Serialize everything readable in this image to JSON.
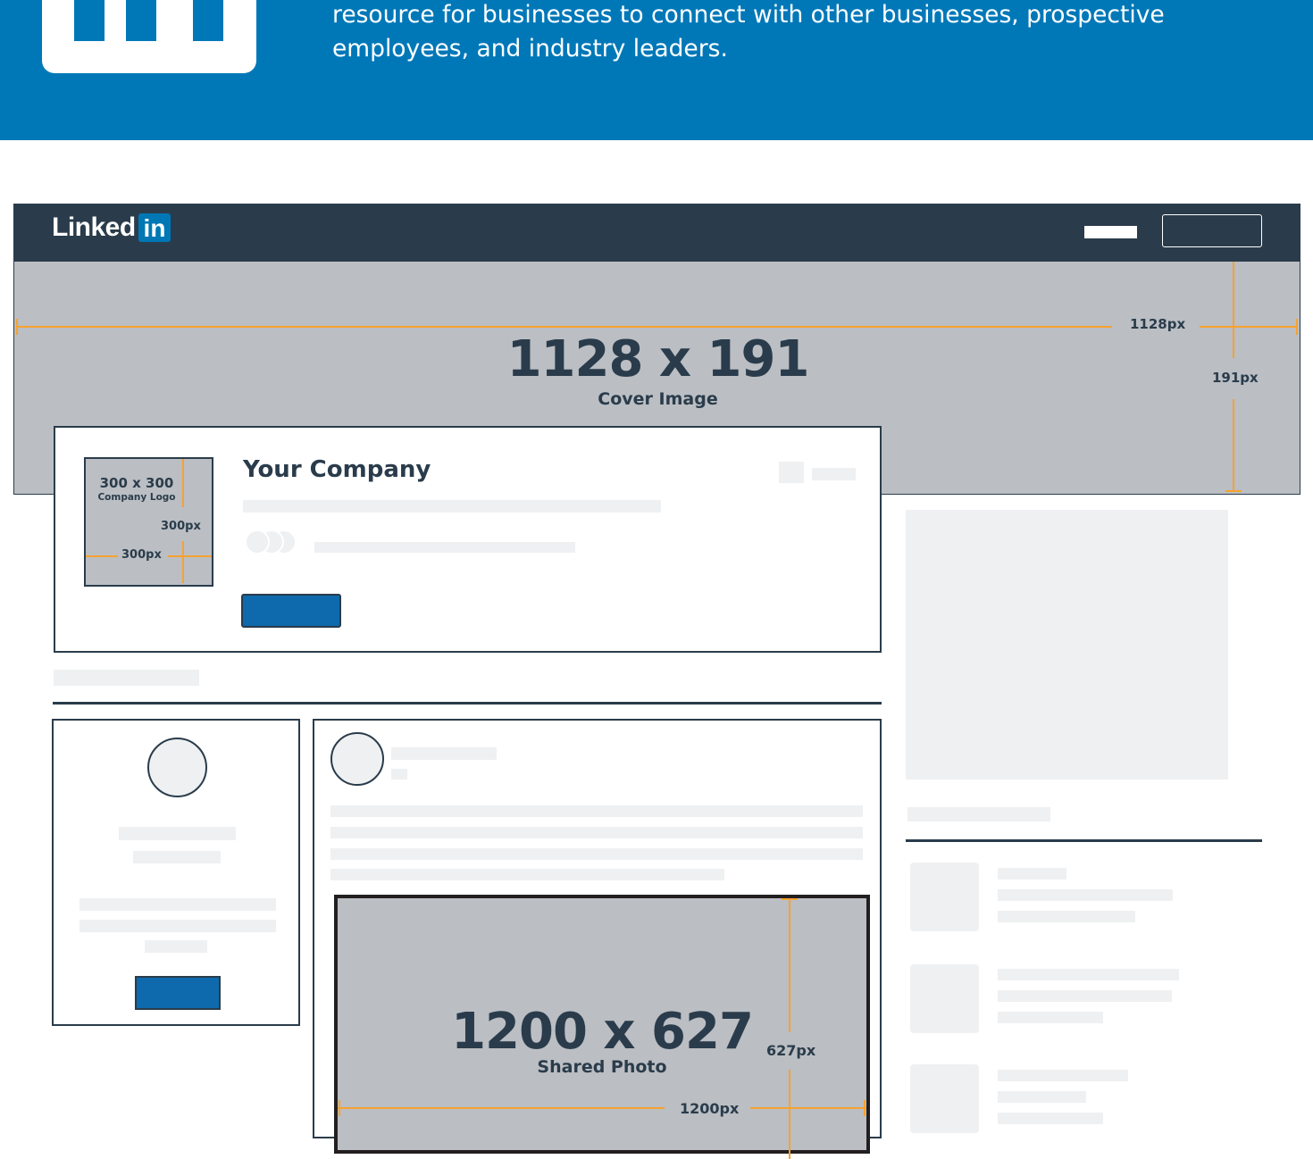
{
  "banner": {
    "background_color": "#0078b8",
    "text_line1": "resource for businesses to connect with other businesses, prospective",
    "text_line2": "employees, and industry leaders.",
    "logo_icon": "linkedin-logo-icon"
  },
  "nav": {
    "brand_word": "Linked",
    "brand_box": "in",
    "background_color": "#2a3c4b"
  },
  "cover": {
    "title": "1128 x 191",
    "subtitle": "Cover Image",
    "width_label": "1128px",
    "height_label": "191px",
    "fill_color": "#bbbec3"
  },
  "company": {
    "name": "Your Company",
    "logo_title": "300 x 300",
    "logo_subtitle": "Company Logo",
    "logo_height_label": "300px",
    "logo_width_label": "300px",
    "button_color": "#0e6aac"
  },
  "shared_photo": {
    "title": "1200 x 627",
    "subtitle": "Shared Photo",
    "height_label": "627px",
    "width_label": "1200px"
  },
  "colors": {
    "accent_orange": "#f6a230",
    "dark": "#2a3c4b",
    "placeholder": "#eff0f2"
  }
}
